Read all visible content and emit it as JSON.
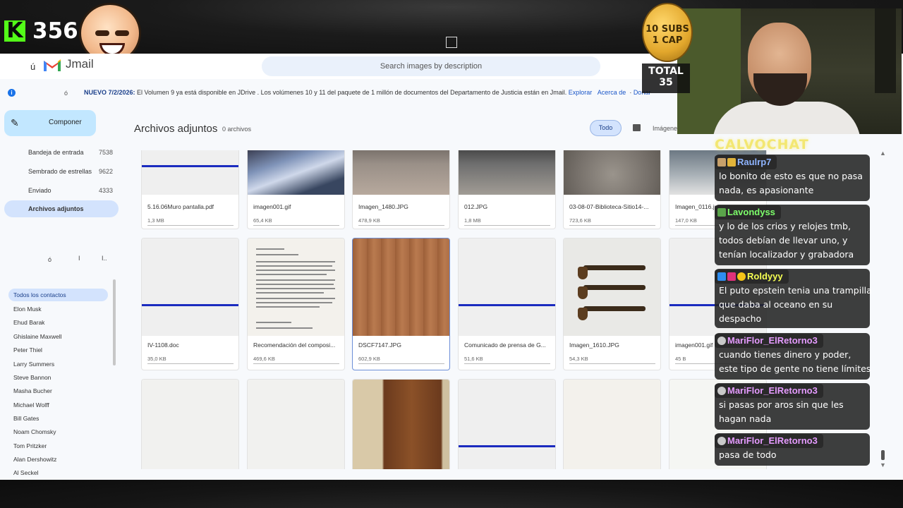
{
  "stream": {
    "viewer_count": "356",
    "kick_logo": "K",
    "coin_line1": "10 SUBS",
    "coin_line2": "1 CAP",
    "total_label": "TOTAL",
    "total_value": "35",
    "chat_title": "CALVOCHAT"
  },
  "app": {
    "brand_accent": "ú",
    "brand_name": "Jmail",
    "search_placeholder": "Search images by description"
  },
  "notice": {
    "accent": "ó",
    "prefix": "NUEVO 7/2/2026:",
    "text": " El Volumen 9 ya está disponible en JDrive . Los volúmenes 10 y 11 del paquete de 1 millón de documentos del Departamento de Justicia están en Jmail. ",
    "link1": "Explorar",
    "link2": "Acerca de",
    "link3": "Donar"
  },
  "sidebar": {
    "compose": "Componer",
    "folders": [
      {
        "name": "Bandeja de entrada",
        "count": "7538"
      },
      {
        "name": "Sembrado de estrellas",
        "count": "9622"
      },
      {
        "name": "Enviado",
        "count": "4333"
      },
      {
        "name": "Archivos adjuntos",
        "count": ""
      }
    ],
    "icons": [
      "ó",
      "I",
      "I.."
    ],
    "contacts_head": "Todos los contactos",
    "contacts": [
      "Elon Musk",
      "Ehud Barak",
      "Ghislaine Maxwell",
      "Peter Thiel",
      "Larry Summers",
      "Steve Bannon",
      "Masha Bucher",
      "Michael Wolff",
      "Bill Gates",
      "Noam Chomsky",
      "Tom Pritzker",
      "Alan Dershowitz",
      "Al Seckel"
    ]
  },
  "main": {
    "title": "Archivos adjuntos",
    "count": "0 archivos",
    "filter_all": "Todo",
    "filter_images": "Imágene"
  },
  "files": [
    {
      "name": "5.16.06Muro pantalla.pdf",
      "size": "1,3 MB"
    },
    {
      "name": "imagen001.gif",
      "size": "65,4 KB"
    },
    {
      "name": "Imagen_1480.JPG",
      "size": "478,9 KB"
    },
    {
      "name": "012.JPG",
      "size": "1,8 MB"
    },
    {
      "name": "03-08-07-Biblioteca-Sitio14-...",
      "size": "723,6 KB"
    },
    {
      "name": "Imagen_0116.jpg",
      "size": "147,0 KB"
    },
    {
      "name": "IV-1108.doc",
      "size": "35,0 KB"
    },
    {
      "name": "Recomendación del composi...",
      "size": "469,6 KB"
    },
    {
      "name": "DSCF7147.JPG",
      "size": "602,9 KB"
    },
    {
      "name": "Comunicado de prensa de G...",
      "size": "51,6 KB"
    },
    {
      "name": "Imagen_1610.JPG",
      "size": "54,3 KB"
    },
    {
      "name": "imagen001.gif",
      "size": "45 B"
    }
  ],
  "chat": [
    {
      "user": "Raulrp7",
      "color": "#8fb4ff",
      "text": "lo bonito de esto es que no pasa nada, es apasionante"
    },
    {
      "user": "Lavondyss",
      "color": "#7dff6a",
      "text": "y lo de los crios y relojes tmb, todos debían de llevar uno, y tenían localizador y grabadora"
    },
    {
      "user": "Roldyyy",
      "color": "#f5ff52",
      "text": "El puto epstein tenia una trampilla que daba al oceano en su despacho"
    },
    {
      "user": "MariFlor_ElRetorno3",
      "color": "#e59bff",
      "text": "cuando tienes dinero y poder, este tipo de gente no tiene límites"
    },
    {
      "user": "MariFlor_ElRetorno3",
      "color": "#e59bff",
      "text": "si pasas por aros sin que les hagan nada"
    },
    {
      "user": "MariFlor_ElRetorno3",
      "color": "#e59bff",
      "text": "pasa de todo"
    }
  ],
  "colors": {
    "accent": "#1a73e8",
    "compose_bg": "#c2e7ff",
    "active_bg": "#d3e3fd",
    "kick_green": "#53fc18"
  }
}
